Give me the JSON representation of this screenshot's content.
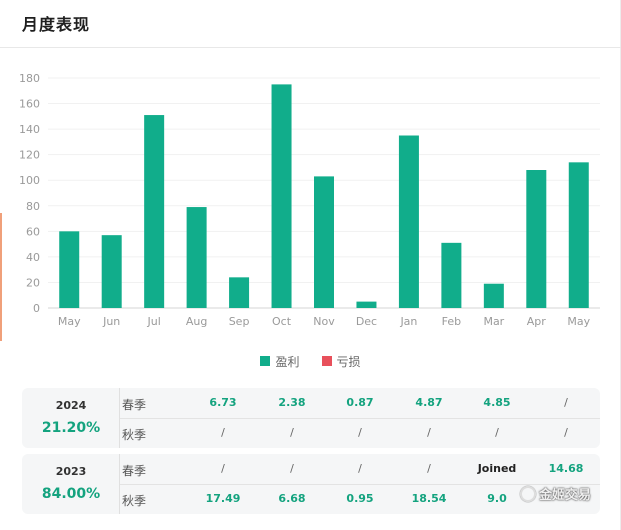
{
  "header": {
    "title": "月度表现"
  },
  "colors": {
    "profit": "#11ad8b",
    "loss": "#e8505b",
    "accent": "#14a37f"
  },
  "chart_data": {
    "type": "bar",
    "categories": [
      "May",
      "Jun",
      "Jul",
      "Aug",
      "Sep",
      "Oct",
      "Nov",
      "Dec",
      "Jan",
      "Feb",
      "Mar",
      "Apr",
      "May"
    ],
    "series": [
      {
        "name": "盈利",
        "values": [
          60,
          57,
          151,
          79,
          24,
          175,
          103,
          5,
          135,
          51,
          19,
          108,
          114
        ]
      },
      {
        "name": "亏损",
        "values": [
          0,
          0,
          0,
          0,
          0,
          0,
          0,
          0,
          0,
          0,
          0,
          0,
          0
        ]
      }
    ],
    "yticks": [
      0,
      20,
      40,
      60,
      80,
      100,
      120,
      140,
      160,
      180
    ],
    "ylim": [
      0,
      180
    ],
    "grid": true,
    "legend": "bottom-center"
  },
  "legend": [
    {
      "label": "盈利",
      "color": "#11ad8b"
    },
    {
      "label": "亏损",
      "color": "#e8505b"
    }
  ],
  "seasons": [
    {
      "year": "2024",
      "percent": "21.20%",
      "rows": [
        {
          "name": "春季",
          "cells": [
            "6.73",
            "2.38",
            "0.87",
            "4.87",
            "4.85",
            "/"
          ]
        },
        {
          "name": "秋季",
          "cells": [
            "/",
            "/",
            "/",
            "/",
            "/",
            "/"
          ]
        }
      ]
    },
    {
      "year": "2023",
      "percent": "84.00%",
      "rows": [
        {
          "name": "春季",
          "cells": [
            "/",
            "/",
            "/",
            "/",
            "Joined",
            "14.68"
          ]
        },
        {
          "name": "秋季",
          "cells": [
            "17.49",
            "6.68",
            "0.95",
            "18.54",
            "9.0",
            ""
          ]
        }
      ]
    }
  ],
  "watermark": {
    "text": "金姬交易"
  }
}
